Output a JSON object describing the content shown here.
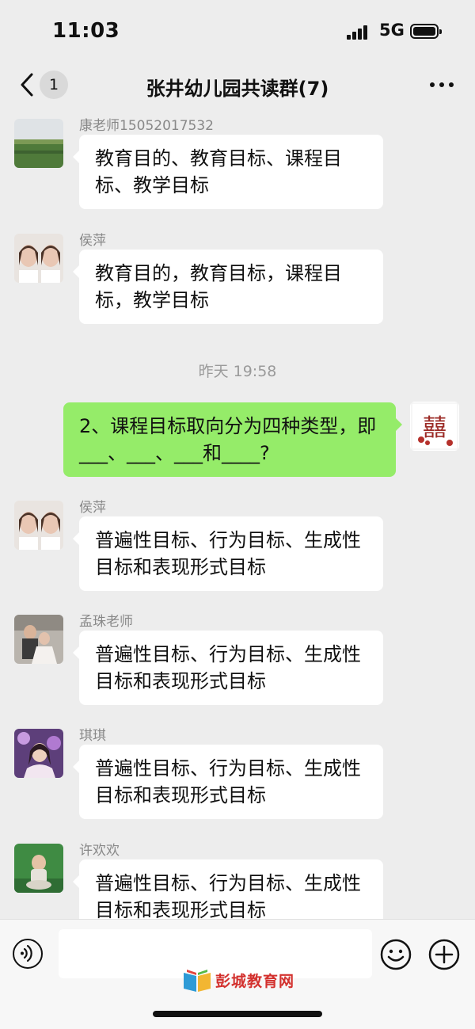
{
  "status": {
    "time": "11:03",
    "network": "5G"
  },
  "header": {
    "unread_count": "1",
    "title": "张井幼儿园共读群(7)"
  },
  "messages": [
    {
      "sender": "康老师15052017532",
      "text": "教育目的、教育目标、课程目标、教学目标",
      "outgoing": false
    },
    {
      "sender": "侯萍",
      "text": "教育目的，教育目标，课程目标，教学目标",
      "outgoing": false
    },
    {
      "timestamp": "昨天 19:58"
    },
    {
      "sender": "",
      "text": "2、课程目标取向分为四种类型，即___、___、___和____?",
      "outgoing": true
    },
    {
      "sender": "侯萍",
      "text": "普遍性目标、行为目标、生成性目标和表现形式目标",
      "outgoing": false
    },
    {
      "sender": "孟珠老师",
      "text": "普遍性目标、行为目标、生成性目标和表现形式目标",
      "outgoing": false
    },
    {
      "sender": "琪琪",
      "text": "普遍性目标、行为目标、生成性目标和表现形式目标",
      "outgoing": false
    },
    {
      "sender": "许欢欢",
      "text": "普遍性目标、行为目标、生成性目标和表现形式目标",
      "outgoing": false
    }
  ],
  "input": {
    "placeholder": ""
  },
  "watermark": {
    "text": "彭城教育网"
  },
  "avatar_self": {
    "text": "囍"
  },
  "icons": [
    "back-chevron-icon",
    "more-icon",
    "voice-icon",
    "emoji-icon",
    "plus-icon"
  ],
  "colors": {
    "background": "#ededed",
    "outgoing_bubble": "#95ec69",
    "incoming_bubble": "#ffffff",
    "watermark": "#d3312e"
  }
}
